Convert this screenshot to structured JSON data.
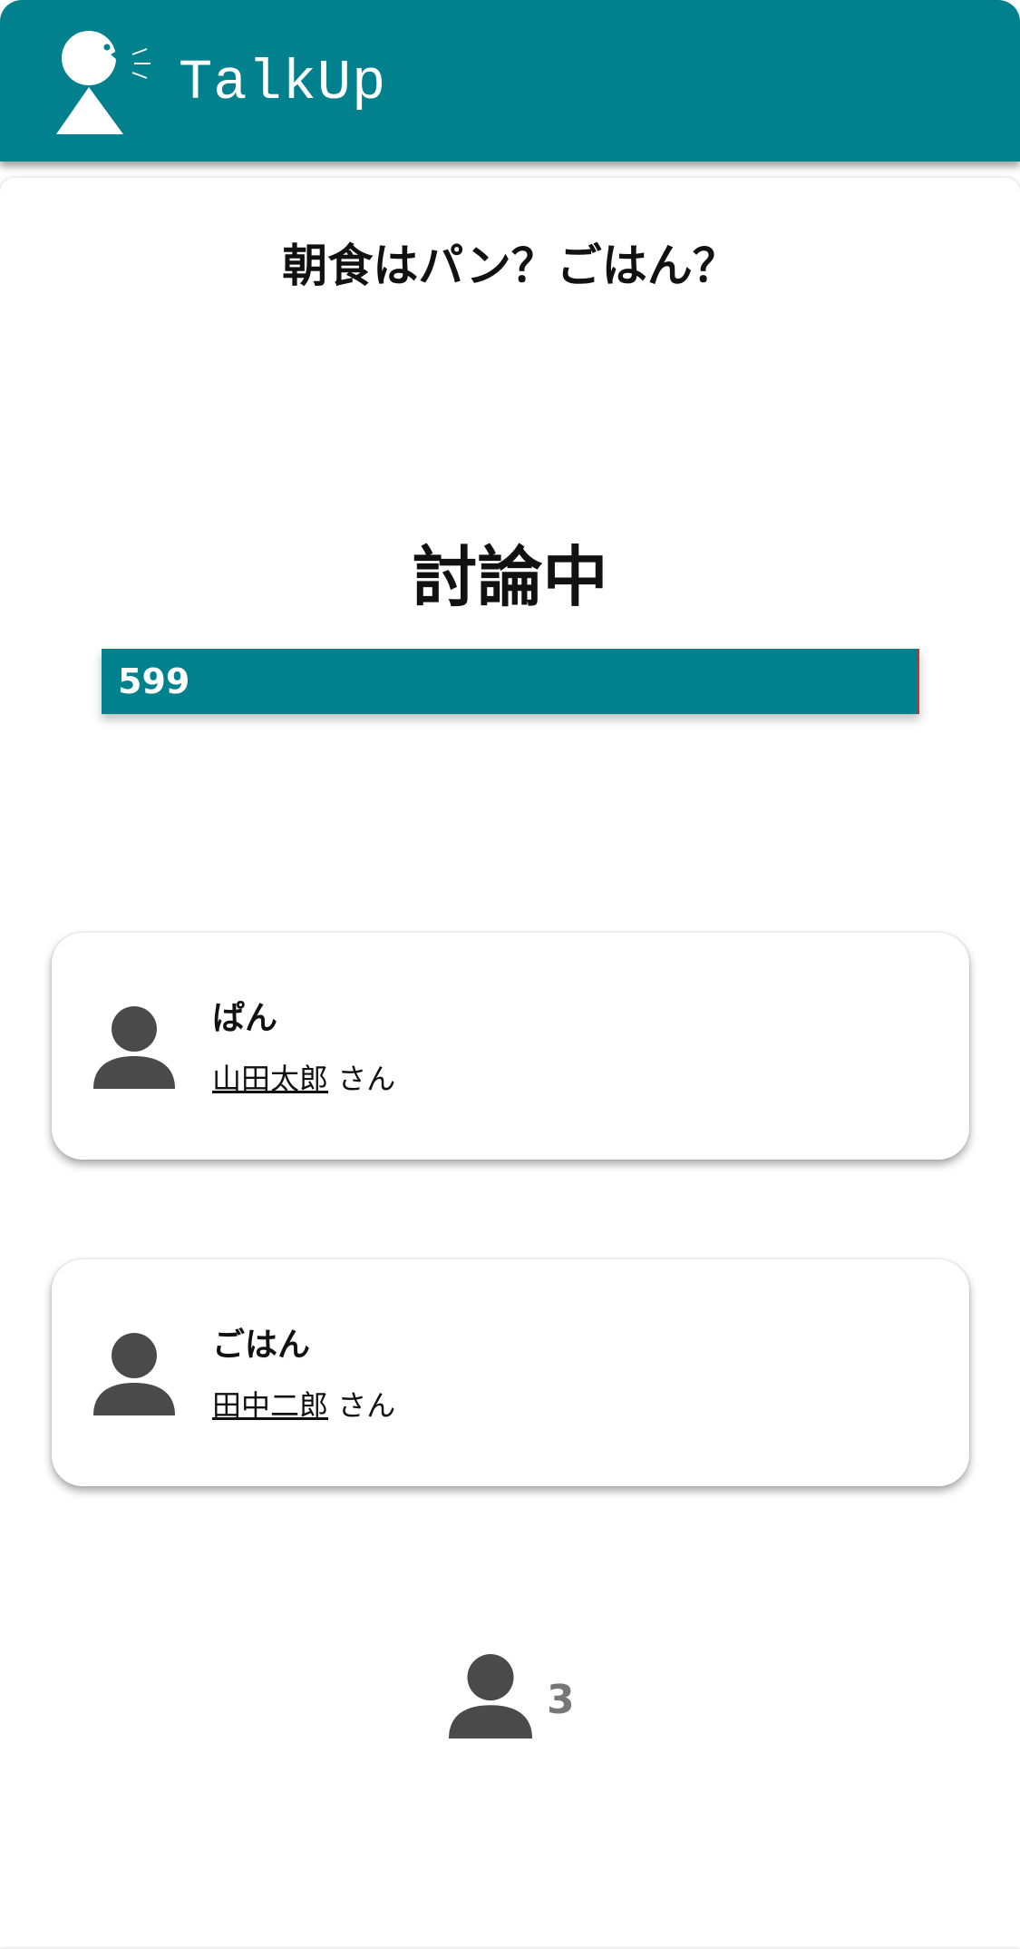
{
  "app": {
    "title": "TalkUp",
    "brand_color": "#00818d",
    "logo_icon": "speaking-person-icon"
  },
  "discussion": {
    "topic": "朝食はパン？ごはん？",
    "status": "討論中",
    "timer": "599",
    "opinions": [
      {
        "text": "ぱん",
        "author": "山田太郎",
        "honorific": " さん",
        "avatar_icon": "user-icon"
      },
      {
        "text": "ごはん",
        "author": "田中二郎",
        "honorific": " さん",
        "avatar_icon": "user-icon"
      }
    ],
    "participant_count": "3",
    "participants_icon": "user-icon"
  }
}
